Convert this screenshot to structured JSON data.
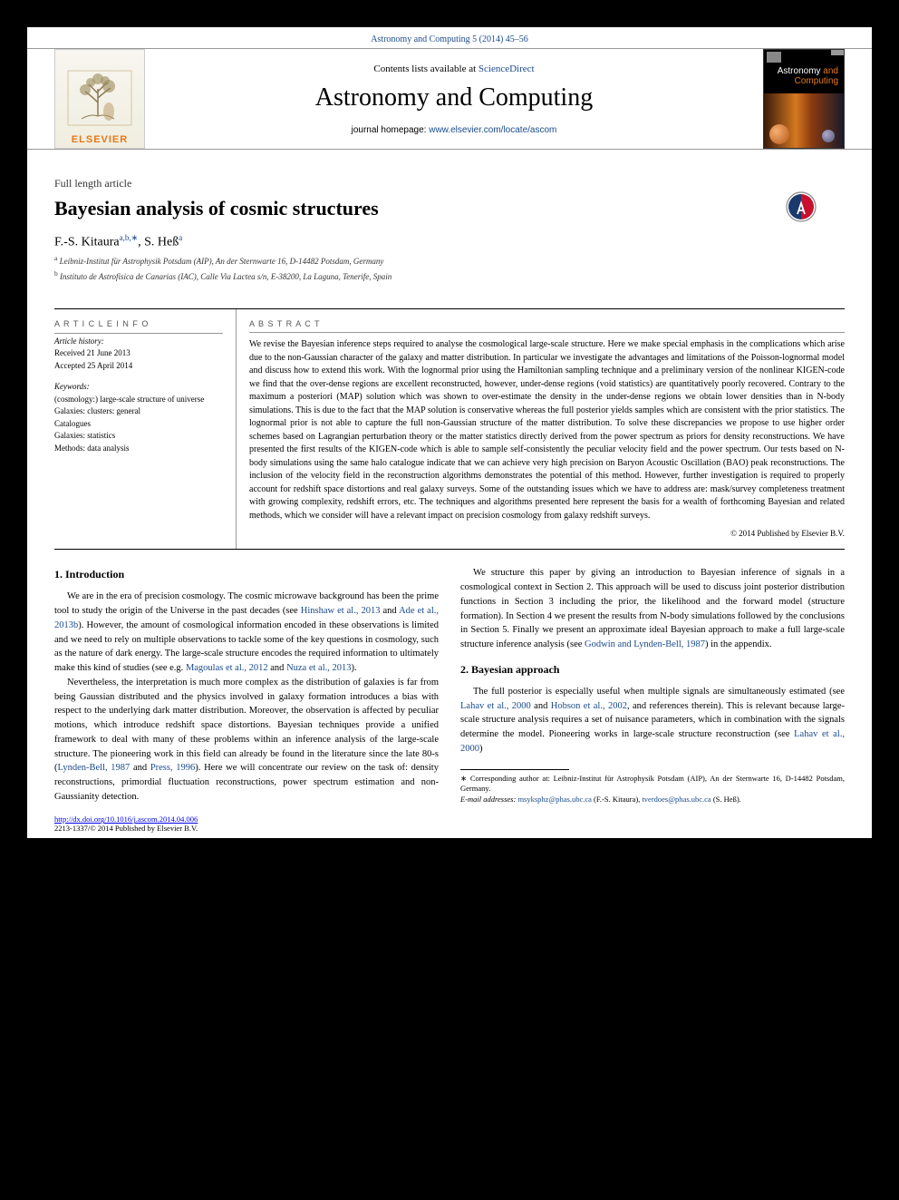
{
  "citation": "Astronomy and Computing 5 (2014) 45–56",
  "banner": {
    "contents_prefix": "Contents lists available at ",
    "contents_link": "ScienceDirect",
    "journal_title": "Astronomy and Computing",
    "homepage_prefix": "journal homepage: ",
    "homepage_link": "www.elsevier.com/locate/ascom",
    "elsevier": "ELSEVIER",
    "cover_ast": "Astronomy",
    "cover_and": " and",
    "cover_comp": "Computing"
  },
  "article": {
    "type": "Full length article",
    "title": "Bayesian analysis of cosmic structures",
    "authors_html": [
      "F.-S. Kitaura",
      "a,b,",
      "∗",
      ", S. Heß",
      "a"
    ],
    "affiliations": [
      {
        "sup": "a",
        "text": " Leibniz-Institut für Astrophysik Potsdam (AIP), An der Sternwarte 16, D-14482 Potsdam, Germany"
      },
      {
        "sup": "b",
        "text": " Instituto de Astrofisica de Canarias (IAC), Calle Via Lactea s/n, E-38200, La Laguna, Tenerife, Spain"
      }
    ]
  },
  "info": {
    "h_article": "A R T I C L E   I N F O",
    "history": [
      "Article history:",
      "Received 21 June 2013",
      "Accepted 25 April 2014"
    ],
    "h_keywords": "Keywords:",
    "keywords": [
      "(cosmology:) large-scale structure of universe",
      "Galaxies: clusters: general",
      "Catalogues",
      "Galaxies: statistics",
      "Methods: data analysis"
    ]
  },
  "abstract": {
    "heading": "A B S T R A C T",
    "text": "We revise the Bayesian inference steps required to analyse the cosmological large-scale structure. Here we make special emphasis in the complications which arise due to the non-Gaussian character of the galaxy and matter distribution. In particular we investigate the advantages and limitations of the Poisson-lognormal model and discuss how to extend this work. With the lognormal prior using the Hamiltonian sampling technique and a preliminary version of the nonlinear KIGEN-code we find that the over-dense regions are excellent reconstructed, however, under-dense regions (void statistics) are quantitatively poorly recovered. Contrary to the maximum a posteriori (MAP) solution which was shown to over-estimate the density in the under-dense regions we obtain lower densities than in N-body simulations. This is due to the fact that the MAP solution is conservative whereas the full posterior yields samples which are consistent with the prior statistics. The lognormal prior is not able to capture the full non-Gaussian structure of the matter distribution. To solve these discrepancies we propose to use higher order schemes based on Lagrangian perturbation theory or the matter statistics directly derived from the power spectrum as priors for density reconstructions. We have presented the first results of the KIGEN-code which is able to sample self-consistently the peculiar velocity field and the power spectrum. Our tests based on N-body simulations using the same halo catalogue indicate that we can achieve very high precision on Baryon Acoustic Oscillation (BAO) peak reconstructions. The inclusion of the velocity field in the reconstruction algorithms demonstrates the potential of this method. However, further investigation is required to properly account for redshift space distortions and real galaxy surveys. Some of the outstanding issues which we have to address are: mask/survey completeness treatment with growing complexity, redshift errors, etc. The techniques and algorithms presented here represent the basis for a wealth of forthcoming Bayesian and related methods, which we consider will have a relevant impact on precision cosmology from galaxy redshift surveys.",
    "copyright": "© 2014 Published by Elsevier B.V."
  },
  "body": {
    "section_heading": "1. Introduction",
    "p1_a": "We are in the era of precision cosmology. The cosmic microwave background has been the prime tool to study the origin of the Universe in the past decades (see ",
    "ref1": "Hinshaw et al., 2013",
    "p1_b": " and ",
    "ref2": "Ade et al., 2013b",
    "p1_c": "). However, the amount of cosmological information encoded in these observations is limited and we need to rely on multiple observations to tackle some of the key questions in cosmology, such as the nature of dark energy. The large-scale structure encodes the required information to ultimately make this kind of studies (see e.g. ",
    "ref3": "Magoulas et al., 2012",
    "p1_d": " and ",
    "ref4": "Nuza et al., 2013",
    "p1_e": ").",
    "p2": "Nevertheless, the interpretation is much more complex as the distribution of galaxies is far from being Gaussian distributed and the physics involved in galaxy formation introduces a bias with respect to the underlying dark matter distribution. Moreover, the observation is affected by peculiar motions, which introduce redshift space distortions. Bayesian techniques provide a unified framework to deal with many of these problems within an inference analysis of the large-scale structure. The pioneering work in this field can already be found in the literature since the late 80-s (",
    "ref5": "Lynden-Bell, 1987",
    "p2_a": " and ",
    "ref6": "Press, 1996",
    "p2_b": "). Here we will concentrate our review on the task of: density reconstructions, primordial fluctuation reconstructions, power spectrum estimation and non-Gaussianity detection.",
    "p3_a": "We structure this paper by giving an introduction to Bayesian inference of signals in a cosmological context in Section 2. This approach will be used to discuss joint posterior distribution functions in Section 3 including the prior, the likelihood and the forward model (structure formation). In Section 4 we present the results from N-body simulations followed by the conclusions in Section 5. Finally we present an approximate ideal Bayesian approach to make a full large-scale structure inference analysis (see ",
    "ref7": "Godwin and Lynden-Bell, 1987",
    "p3_b": ") in the appendix.",
    "h2": "2. Bayesian approach",
    "p4_a": "The full posterior is especially useful when multiple signals are simultaneously estimated (see ",
    "ref8": "Lahav et al., 2000",
    "p4_b": " and ",
    "ref9": "Hobson et al., 2002",
    "p4_c": ", and references therein). This is relevant because large-scale structure analysis requires a set of nuisance parameters, which in combination with the signals determine the model. Pioneering works in large-scale structure reconstruction (see ",
    "ref10": "Lahav et al., 2000",
    "p4_d": ")"
  },
  "footnote": {
    "star": "∗",
    "label": " Corresponding author at: Leibniz-Institut für Astrophysik Potsdam (AIP), An der Sternwarte 16, D-14482 Potsdam, Germany.",
    "email_label": "E-mail addresses: ",
    "email1": "msyksphz@phas.ubc.ca",
    "email1_who": " (F.-S. Kitaura), ",
    "email2": "tverdoes@phas.ubc.ca",
    "email2_who": " (S. Heß)."
  },
  "doi": {
    "link": "http://dx.doi.org/10.1016/j.ascom.2014.04.006",
    "rights": "2213-1337/© 2014 Published by Elsevier B.V."
  }
}
